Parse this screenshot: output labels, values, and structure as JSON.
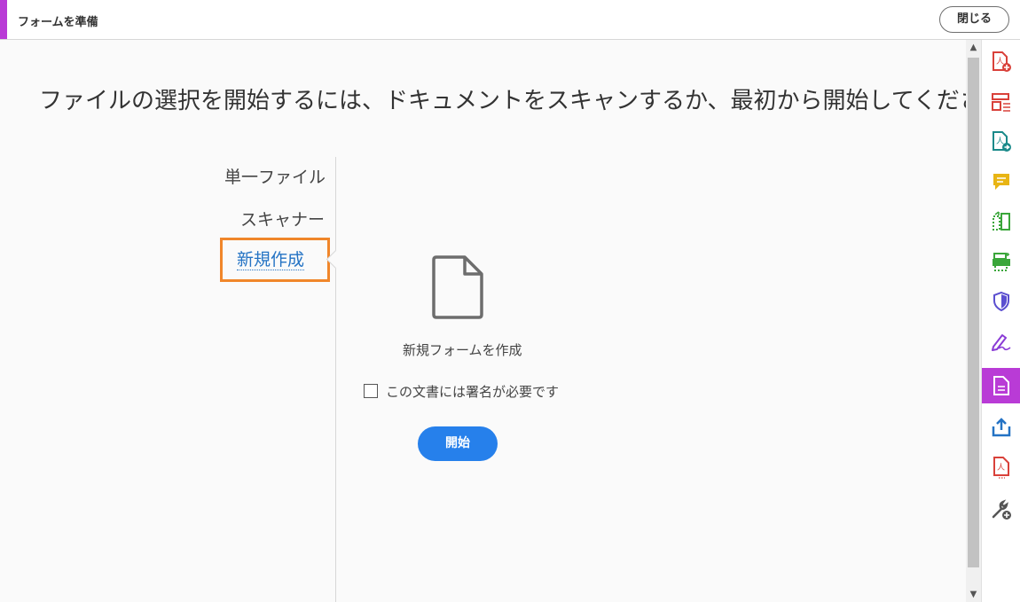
{
  "header": {
    "title": "フォームを準備",
    "close_label": "閉じる"
  },
  "main": {
    "heading": "ファイルの選択を開始するには、ドキュメントをスキャンするか、最初から開始してください",
    "nav": [
      {
        "label": "単一ファイル"
      },
      {
        "label": "スキャナー"
      },
      {
        "label": "新規作成",
        "selected": true
      }
    ],
    "create_label": "新規フォームを作成",
    "signature_checkbox": {
      "label": "この文書には署名が必要です",
      "checked": false
    },
    "start_label": "開始"
  },
  "colors": {
    "accent": "#b93bd6",
    "primary_button": "#2680eb",
    "selected_link": "#2473c4",
    "highlight": "#f0862a"
  },
  "right_tools": [
    "create-pdf-icon",
    "organize-pages-icon",
    "export-pdf-icon",
    "comment-icon",
    "compare-icon",
    "scan-icon",
    "protect-icon",
    "fill-sign-icon",
    "prepare-form-icon",
    "share-icon",
    "pdf-file-icon",
    "more-tools-icon"
  ]
}
